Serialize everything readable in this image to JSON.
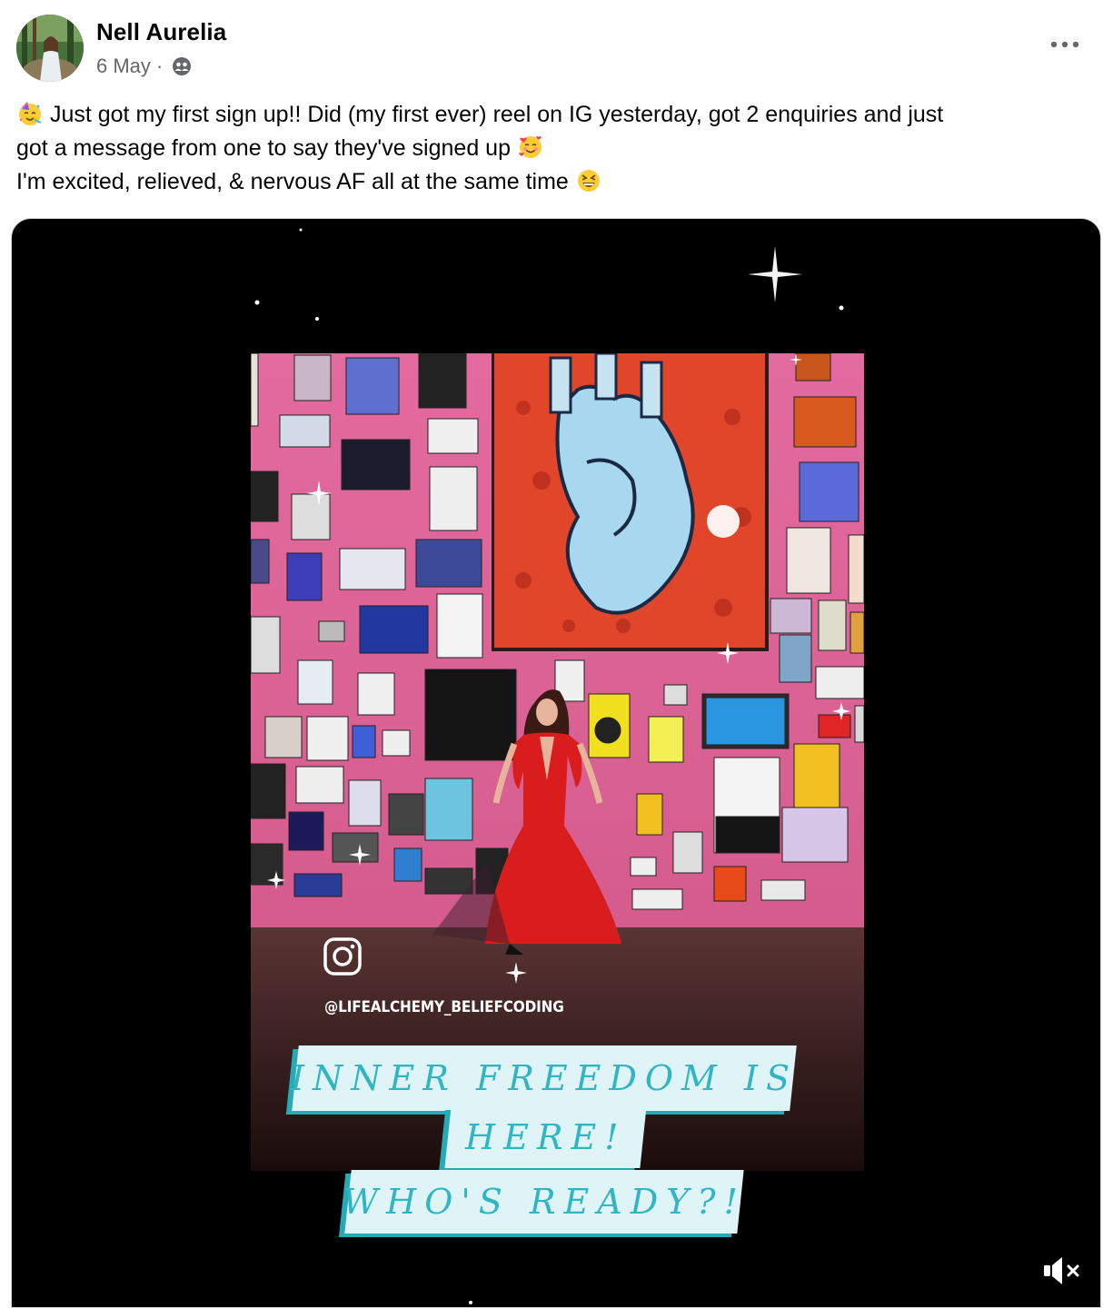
{
  "post": {
    "author": "Nell Aurelia",
    "date": "6 May",
    "separator": "·",
    "audience_icon": "friends-icon",
    "more_icon": "more-horizontal-icon",
    "message": {
      "line1": "Just got my first sign up!! Did (my first ever) reel on IG yesterday, got 2 enquiries and just",
      "line2": "got a message from one to say they've signed up",
      "line3": "I'm excited, relieved, & nervous AF all at the same time",
      "emoji_start": "partying-face",
      "emoji_line2": "smiling-face-with-hearts",
      "emoji_line3": "grinning-squinting-face"
    }
  },
  "video": {
    "handle": "@LIFEALCHEMY_BELIEFCODING",
    "caption_line1": "INNER FREEDOM IS",
    "caption_line2": "HERE!",
    "caption_line3": "WHO'S READY?!",
    "mute_icon": "speaker-muted-icon",
    "brand_icon": "instagram-icon",
    "wall_color": "#e0679a",
    "dress_color": "#d91d1d",
    "caption_color": "#2fb5c3"
  }
}
